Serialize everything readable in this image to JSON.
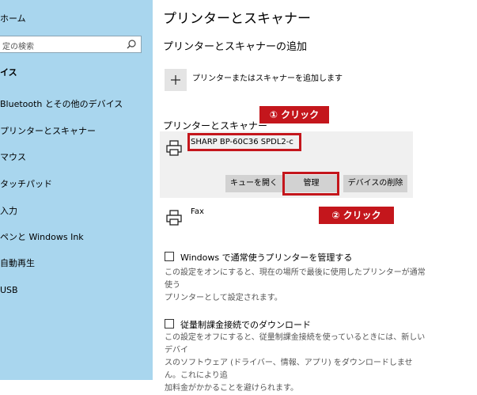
{
  "sidebar": {
    "home": "ホーム",
    "search_placeholder": "定の検索",
    "group_label": "イス",
    "items": [
      {
        "label": "Bluetooth とその他のデバイス"
      },
      {
        "label": "プリンターとスキャナー"
      },
      {
        "label": "マウス"
      },
      {
        "label": "タッチパッド"
      },
      {
        "label": "入力"
      },
      {
        "label": "ペンと Windows Ink"
      },
      {
        "label": "自動再生"
      },
      {
        "label": "USB"
      }
    ]
  },
  "main": {
    "title": "プリンターとスキャナー",
    "add_section_title": "プリンターとスキャナーの追加",
    "add_label": "プリンターまたはスキャナーを追加します",
    "printers_section_title": "プリンターとスキャナー",
    "printer_name": "SHARP BP-60C36 SPDL2-c",
    "buttons": {
      "queue": "キューを開く",
      "manage": "管理",
      "remove": "デバイスの削除"
    },
    "fax_label": "Fax",
    "option1": {
      "label": "Windows で通常使うプリンターを管理する",
      "desc_lines": [
        "この設定をオンにすると、現在の場所で最後に使用したプリンターが通常使う",
        "プリンターとして設定されます。"
      ]
    },
    "option2": {
      "label": "従量制課金接続でのダウンロード",
      "desc_lines": [
        "この設定をオフにすると、従量制課金接続を使っているときには、新しいデバイ",
        "スのソフトウェア (ドライバー、情報、アプリ) をダウンロードしません。これにより追",
        "加料金がかかることを避けられます。"
      ]
    }
  },
  "annotations": {
    "callout1": "① クリック",
    "callout2": "② クリック",
    "accent_color": "#c4161c"
  }
}
